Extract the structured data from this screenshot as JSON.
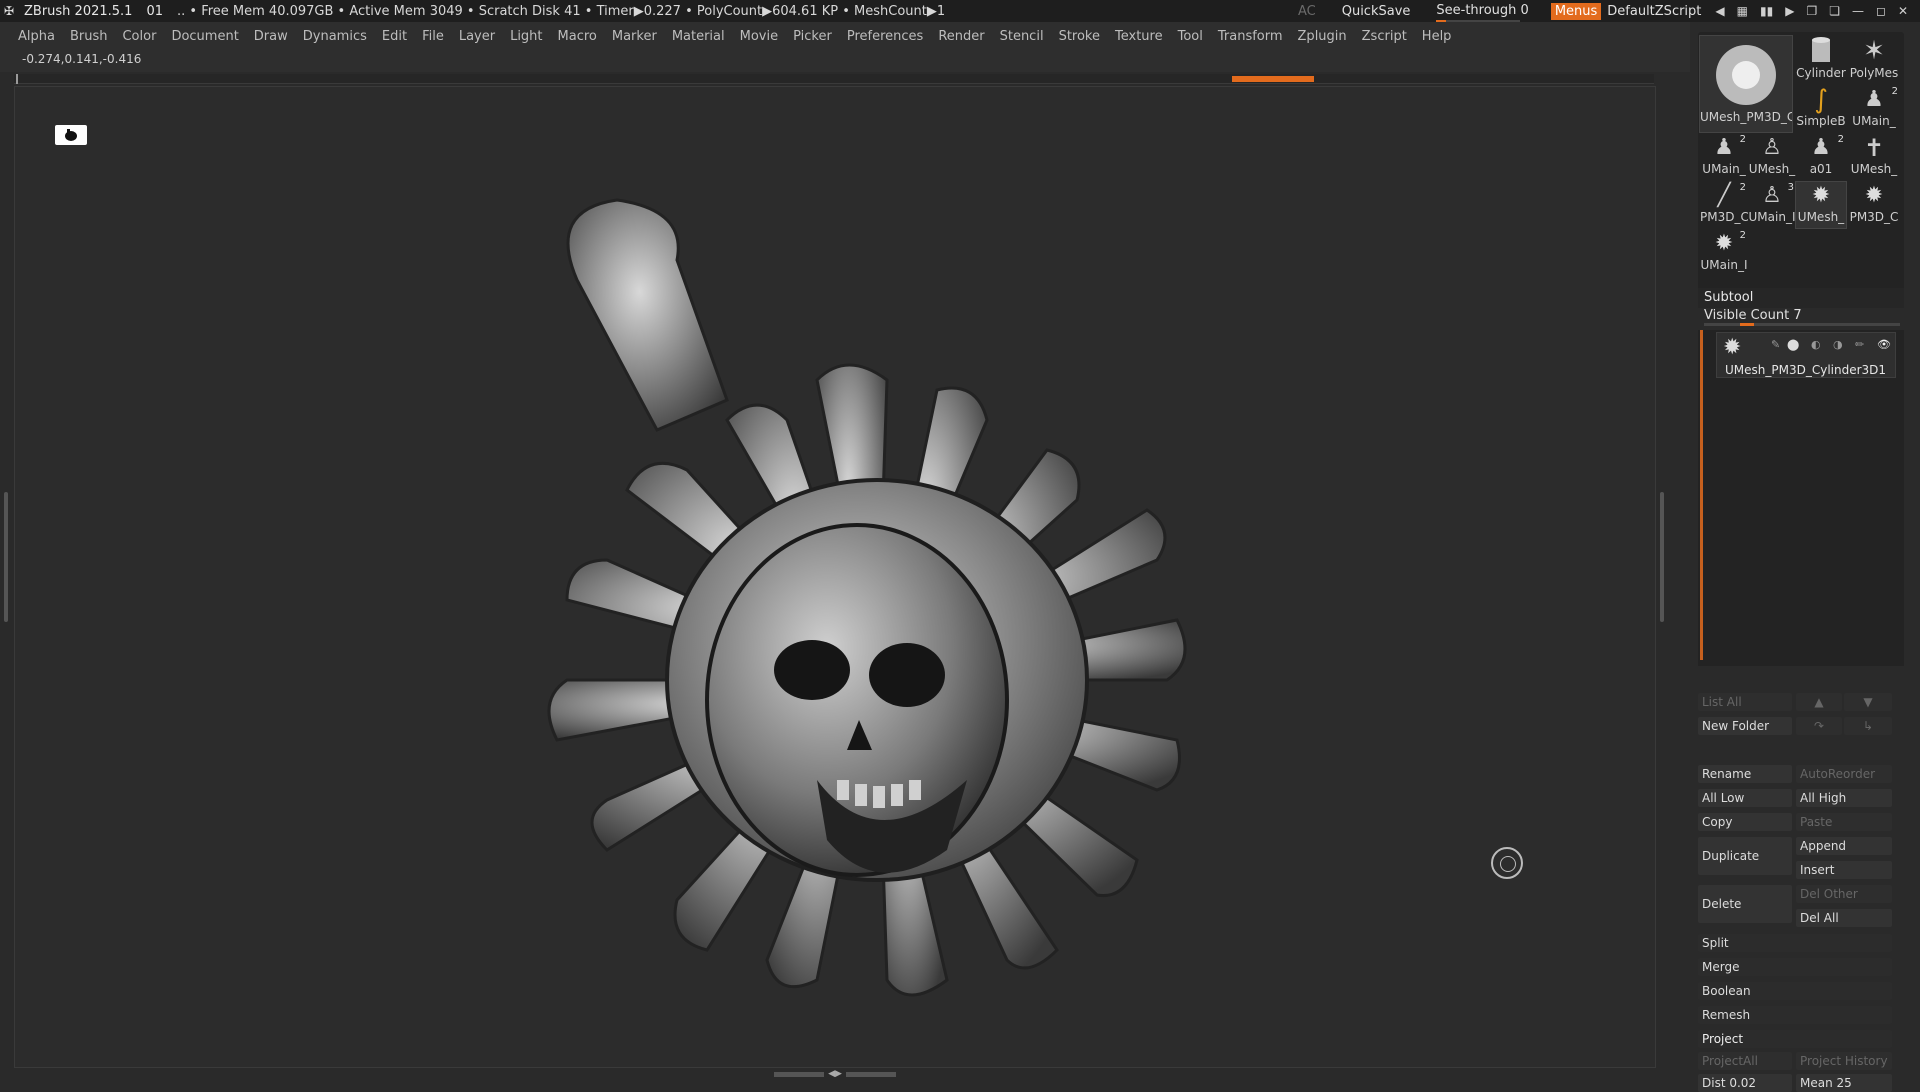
{
  "titlebar": {
    "app": "ZBrush 2021.5.1",
    "doc": "01",
    "stats": ".. • Free Mem 40.097GB • Active Mem 3049 • Scratch Disk 41 •  Timer▶0.227 • PolyCount▶604.61 KP  • MeshCount▶1",
    "ac": "AC",
    "quicksave": "QuickSave",
    "see_through": "See-through  0",
    "menus": "Menus",
    "script": "DefaultZScript"
  },
  "menu": [
    "Alpha",
    "Brush",
    "Color",
    "Document",
    "Draw",
    "Dynamics",
    "Edit",
    "File",
    "Layer",
    "Light",
    "Macro",
    "Marker",
    "Material",
    "Movie",
    "Picker",
    "Preferences",
    "Render",
    "Stencil",
    "Stroke",
    "Texture",
    "Tool",
    "Transform",
    "Zplugin",
    "Zscript",
    "Help"
  ],
  "coords": "-0.274,0.141,-0.416",
  "tools": {
    "items": [
      {
        "label": "UMesh_PM3D_C",
        "count": ""
      },
      {
        "label": "Cylinder",
        "count": ""
      },
      {
        "label": "PolyMes",
        "count": ""
      },
      {
        "label": "SimpleB",
        "count": ""
      },
      {
        "label": "UMain_",
        "count": "2"
      },
      {
        "label": "UMain_",
        "count": "2"
      },
      {
        "label": "UMesh_",
        "count": ""
      },
      {
        "label": "a01",
        "count": "2"
      },
      {
        "label": "UMesh_",
        "count": ""
      },
      {
        "label": "PM3D_C",
        "count": "2"
      },
      {
        "label": "UMain_I",
        "count": "3"
      },
      {
        "label": "UMesh_",
        "count": ""
      },
      {
        "label": "PM3D_C",
        "count": ""
      },
      {
        "label": "UMain_I",
        "count": "2"
      }
    ]
  },
  "subtool": {
    "title": "Subtool",
    "visible_count": "Visible Count 7",
    "item_name": "UMesh_PM3D_Cylinder3D1",
    "buttons": {
      "list_all": "List All",
      "new_folder": "New Folder",
      "rename": "Rename",
      "autoreorder": "AutoReorder",
      "all_low": "All Low",
      "all_high": "All High",
      "copy": "Copy",
      "paste": "Paste",
      "duplicate": "Duplicate",
      "append": "Append",
      "insert": "Insert",
      "delete": "Delete",
      "del_other": "Del Other",
      "del_all": "Del All",
      "split": "Split",
      "merge": "Merge",
      "boolean": "Boolean",
      "remesh": "Remesh",
      "project": "Project",
      "project_all": "ProjectAll",
      "project_history": "Project History",
      "dist": "Dist 0.02",
      "mean": "Mean 25"
    }
  },
  "colors": {
    "accent": "#e36b1d",
    "bg": "#2a2a2a",
    "canvas": "#2c2c2c"
  }
}
